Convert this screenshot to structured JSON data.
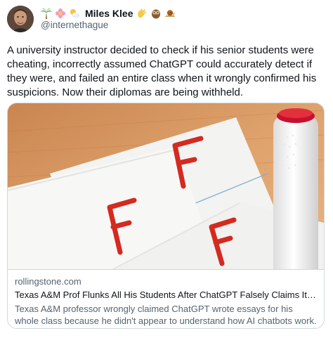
{
  "author": {
    "display_name": "Miles Klee",
    "handle": "@internethague",
    "name_emojis": [
      "palm-tree-icon",
      "flower-icon",
      "sun-cloud-icon"
    ],
    "suffix_emojis": [
      "clapping-hand-icon",
      "owl-icon",
      "snail-icon"
    ]
  },
  "tweet": {
    "text": "A university instructor decided to check if his senior students were cheating, incorrectly assumed ChatGPT could accurately detect if they were, and failed an entire class when it wrongly confirmed his suspicions. Now their diplomas are being withheld."
  },
  "link_card": {
    "image_letters": [
      "F",
      "F",
      "F"
    ],
    "domain": "rollingstone.com",
    "title": "Texas A&M Prof Flunks All His Students After ChatGPT Falsely Claims It Wrote Their Papers",
    "description": "Texas A&M professor wrongly claimed ChatGPT wrote essays for his whole class because he didn't appear to understand how AI chatbots work."
  },
  "colors": {
    "text": "#0f1419",
    "secondary_text": "#536471",
    "border": "#cfd9de",
    "grade_red": "#d42a20",
    "marker_cap": "#c8102e",
    "desk_wood": "#d59561"
  }
}
